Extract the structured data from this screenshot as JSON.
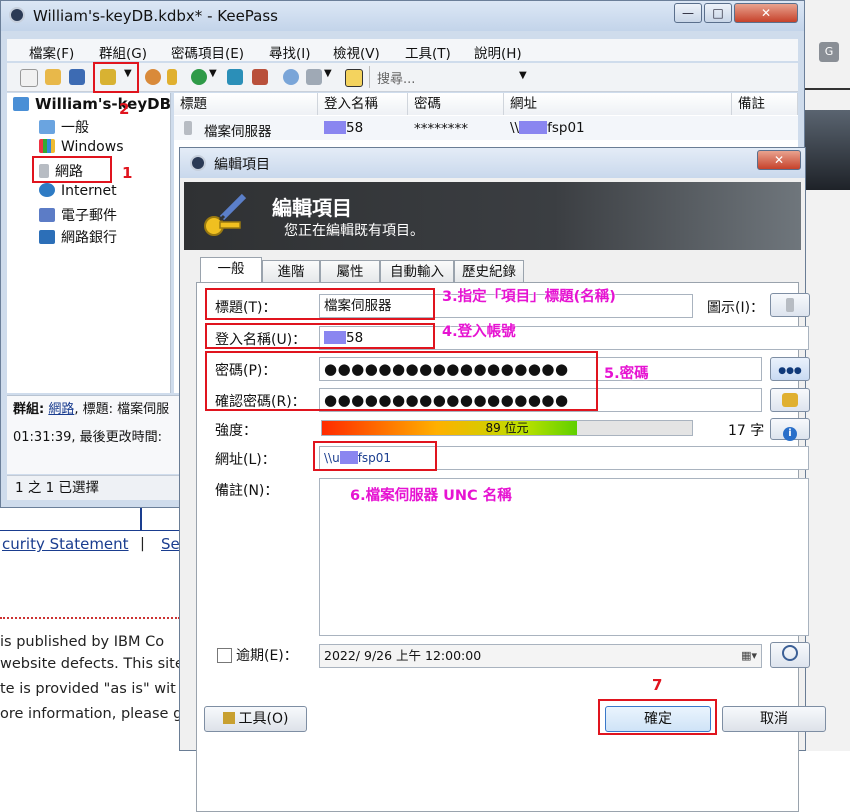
{
  "background": {
    "link_text": "curity Statement",
    "separator": "|",
    "link2": "Se",
    "lines": [
      " is published by IBM Co",
      "website defects. This site",
      "te is provided \"as is\" wit",
      "ore information, please g"
    ]
  },
  "main": {
    "title": "William's-keyDB.kdbx* - KeePass",
    "window_buttons": {
      "minimize": "—",
      "maximize": "□",
      "close": "✕"
    },
    "menu": [
      "檔案(F)",
      "群組(G)",
      "密碼項目(E)",
      "尋找(I)",
      "檢視(V)",
      "工具(T)",
      "說明(H)"
    ],
    "search_placeholder": "搜尋...",
    "tree": {
      "root": "William's-keyDB",
      "items": [
        "一般",
        "Windows",
        "網路",
        "Internet",
        "電子郵件",
        "網路銀行"
      ]
    },
    "columns": [
      "標題",
      "登入名稱",
      "密碼",
      "網址",
      "備註"
    ],
    "row": {
      "title": "檔案伺服器",
      "user_suffix": "58",
      "password": "********",
      "url_prefix": "\\\\",
      "url_suffix": "fsp01"
    },
    "details": {
      "group_label": "群組:",
      "group_link": "網路",
      "title_part": ", 標題: 檔案伺服",
      "line2": "01:31:39, 最後更改時間:"
    },
    "status": "1 之 1 已選擇"
  },
  "dialog": {
    "title": "編輯項目",
    "close": "✕",
    "banner_title": "編輯項目",
    "banner_subtitle": "您正在編輯既有項目。",
    "tabs": [
      "一般",
      "進階",
      "屬性",
      "自動輸入",
      "歷史紀錄"
    ],
    "labels": {
      "title": "標題(T)：",
      "username": "登入名稱(U)：",
      "password": "密碼(P)：",
      "repeat": "確認密碼(R)：",
      "quality": "強度：",
      "url": "網址(L)：",
      "notes": "備註(N)：",
      "icon": "圖示(I)：",
      "expires": "逾期(E)："
    },
    "values": {
      "title": "檔案伺服器",
      "username_suffix": "58",
      "password": "●●●●●●●●●●●●●●●●●●",
      "repeat": "●●●●●●●●●●●●●●●●●●",
      "url_prefix": "\\\\u",
      "url_suffix": "fsp01",
      "expires": "2022/ 9/26 上午 12:00:00"
    },
    "quality": {
      "bits": "89 位元",
      "fraction": 0.69,
      "chars": "17 字"
    },
    "buttons": {
      "tools": "工具(O)",
      "ok": "確定",
      "cancel": "取消",
      "show_pw": "●●●"
    }
  },
  "annotations": {
    "n1": "1",
    "n2": "2",
    "n7": "7",
    "c3": "3.指定「項目」標題(名稱)",
    "c4": "4.登入帳號",
    "c5": "5.密碼",
    "c6": "6.檔案伺服器 UNC 名稱"
  },
  "colors": {
    "annotation_red": "#e0141e",
    "annotation_magenta": "#e613d2",
    "redaction": "#8a86f0"
  }
}
